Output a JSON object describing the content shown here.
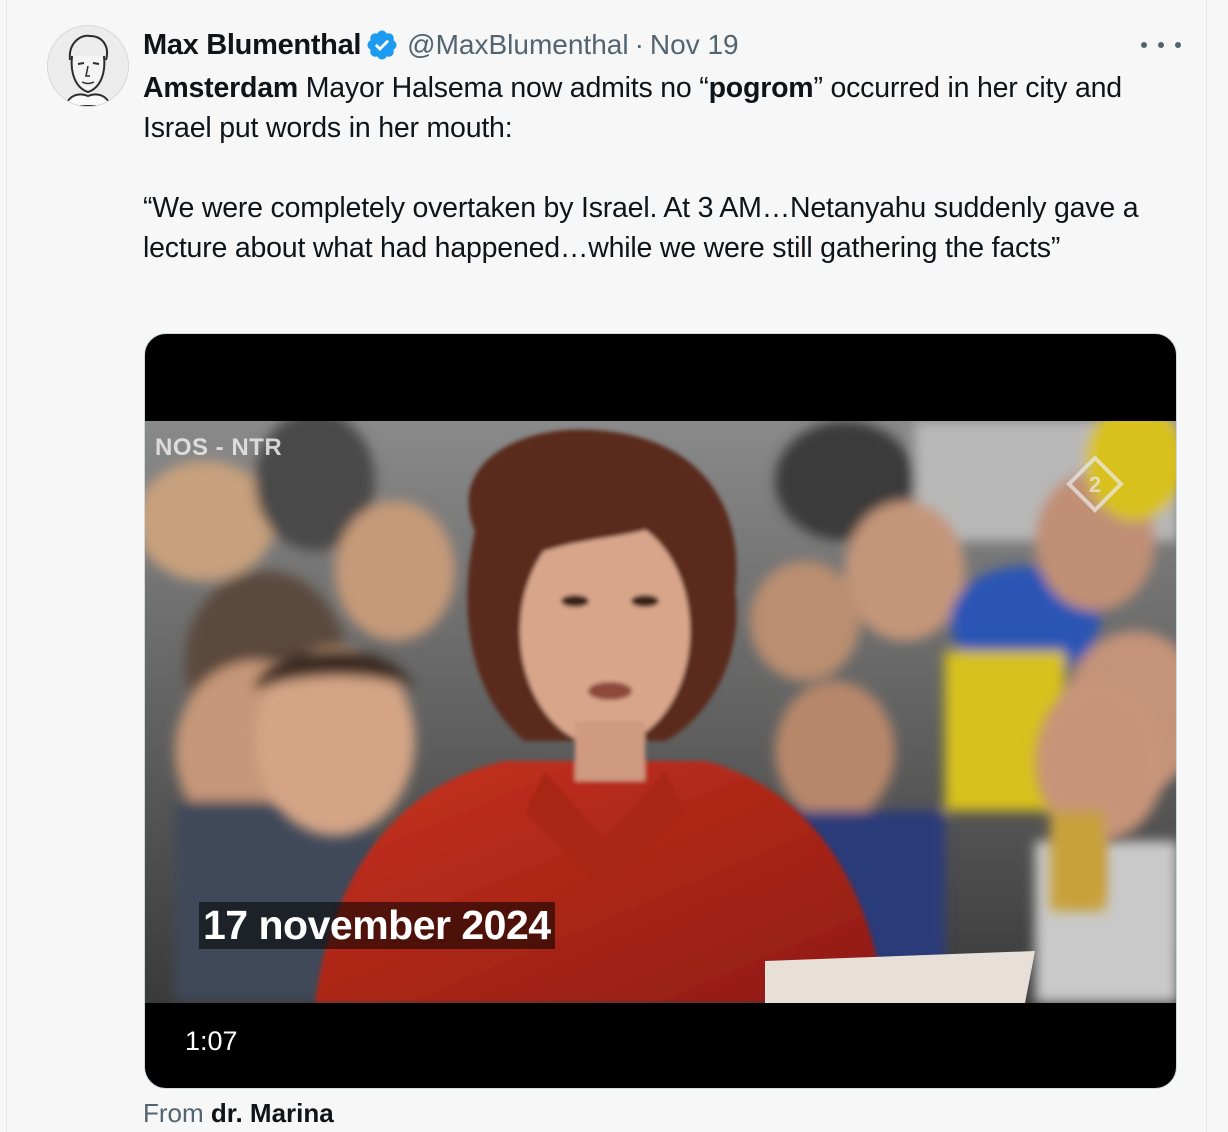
{
  "author": {
    "display_name": "Max Blumenthal",
    "handle": "@MaxBlumenthal",
    "separator": "·",
    "date": "Nov 19",
    "verified": true
  },
  "colors": {
    "verified_badge": "#1d9bf0",
    "text_primary": "#0f1419",
    "text_secondary": "#536471",
    "coat_red": "#b4241a"
  },
  "tweet": {
    "line1_bold_a": "Amsterdam",
    "line1_text_a": " Mayor Halsema now admits no “",
    "line1_bold_b": "pogrom",
    "line1_text_b": "” occurred in her city and Israel put words in her mouth:",
    "quote": "“We were completely overtaken by Israel. At 3 AM…Netanyahu suddenly gave a lecture about what had happened…while we were still gathering the facts”"
  },
  "media": {
    "broadcaster_label": "NOS - NTR",
    "caption_date": "17 november 2024",
    "duration": "1:07",
    "channel_logo": "npo-2-logo"
  },
  "source": {
    "from_label": "From",
    "from_name": "dr. Marina"
  },
  "icons": {
    "more": "more-options-icon",
    "verified": "verified-badge-icon"
  }
}
